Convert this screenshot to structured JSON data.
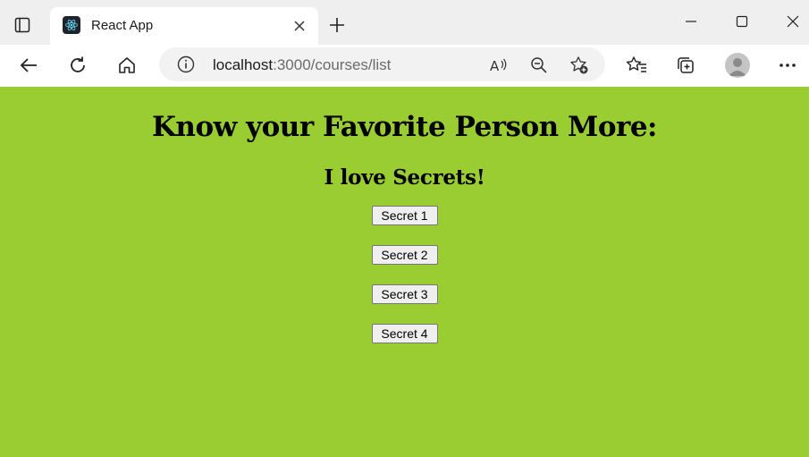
{
  "browser": {
    "tab_title": "React App",
    "url_host": "localhost",
    "url_rest": ":3000/courses/list"
  },
  "page": {
    "heading": "Know your Favorite Person More:",
    "subheading": "I love Secrets!",
    "buttons": [
      "Secret 1",
      "Secret 2",
      "Secret 3",
      "Secret 4"
    ]
  },
  "colors": {
    "page_background": "#9acd32"
  },
  "icons": [
    "tab-actions-icon",
    "react-icon",
    "close-icon",
    "plus-icon",
    "minimize-icon",
    "maximize-icon",
    "back-icon",
    "reload-icon",
    "home-icon",
    "info-icon",
    "read-aloud-icon",
    "zoom-out-icon",
    "add-favorite-icon",
    "favorites-icon",
    "collections-icon",
    "profile-icon",
    "more-icon"
  ]
}
